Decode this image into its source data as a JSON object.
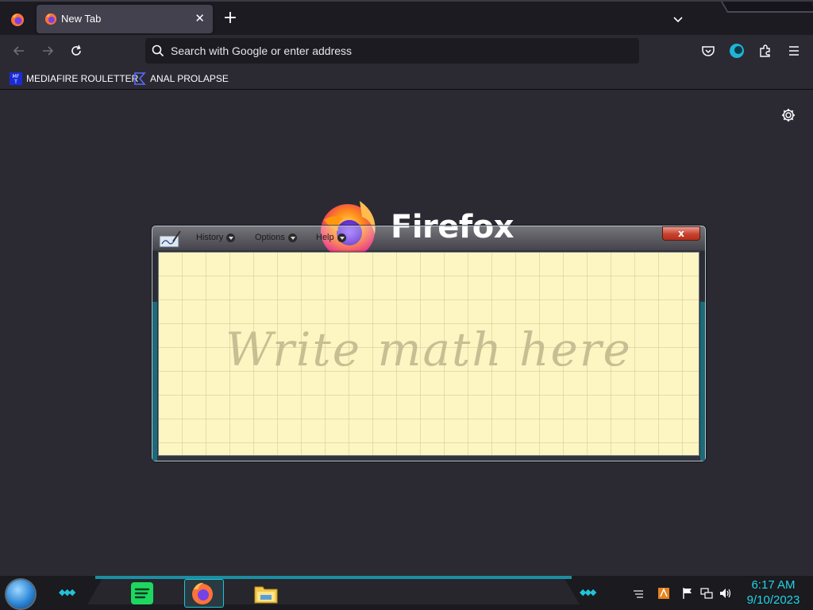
{
  "browser": {
    "tabs": [
      {
        "title": "New Tab",
        "active": true
      }
    ],
    "urlbar": {
      "placeholder": "Search with Google or enter address",
      "value": ""
    },
    "bookmarks": [
      {
        "label": "MEDIAFIRE ROULETTER",
        "icon": "mediafire-icon"
      },
      {
        "label": "ANAL PROLAPSE",
        "icon": "sigma-icon"
      }
    ]
  },
  "newtab": {
    "brand": "Firefox"
  },
  "math_input_panel": {
    "menus": {
      "history": "History",
      "options": "Options",
      "help": "Help"
    },
    "close_label": "x",
    "hint": "Write math here"
  },
  "taskbar": {
    "time": "6:17 AM",
    "date": "9/10/2023",
    "pinned": [
      "spotify-icon",
      "firefox-icon",
      "file-explorer-icon"
    ],
    "tray": [
      "app-tray-icon",
      "flag-icon",
      "network-icon",
      "volume-icon"
    ]
  },
  "colors": {
    "accent_cyan": "#22d3e6",
    "chrome_dark": "#1c1b22",
    "page_bg": "#2b2a33",
    "pad_yellow": "#fdf5c2"
  }
}
